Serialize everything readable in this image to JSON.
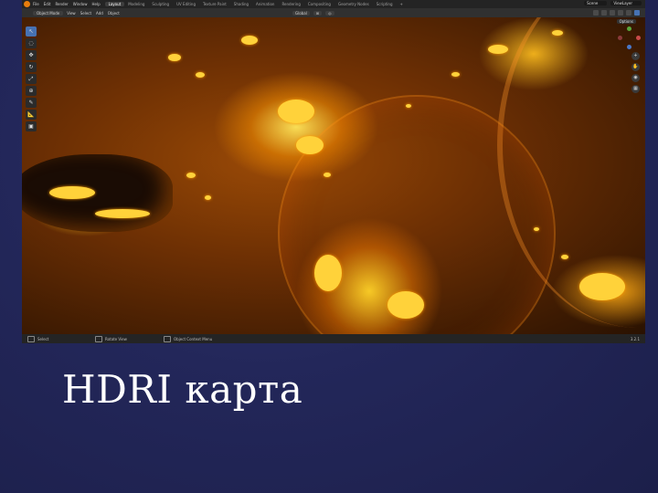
{
  "slide": {
    "title": "HDRI карта"
  },
  "blender": {
    "menu": [
      "File",
      "Edit",
      "Render",
      "Window",
      "Help"
    ],
    "workspaces": [
      "Layout",
      "Modeling",
      "Sculpting",
      "UV Editing",
      "Texture Paint",
      "Shading",
      "Animation",
      "Rendering",
      "Compositing",
      "Geometry Nodes",
      "Scripting"
    ],
    "active_workspace": "Layout",
    "scene": "Scene",
    "view_layer": "ViewLayer",
    "mode": "Object Mode",
    "view_menu": [
      "View",
      "Select",
      "Add",
      "Object"
    ],
    "transform_orientation": "Global",
    "options_label": "Options",
    "status": {
      "select": "Select",
      "rotate": "Rotate View",
      "context": "Object Context Menu",
      "version": "3.2.1"
    }
  },
  "colors": {
    "slide_bg": "#23275a",
    "accent": "#e87d0d",
    "active_blue": "#4772b3"
  }
}
